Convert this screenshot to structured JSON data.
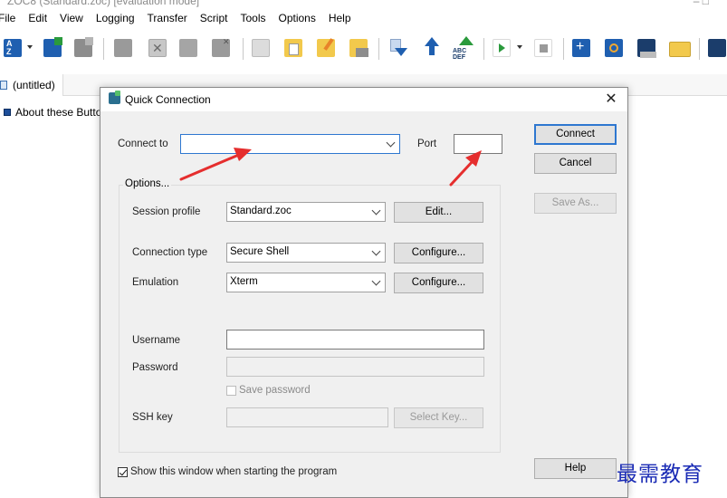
{
  "window": {
    "title": "ZOC8 (Standard.zoc) [evaluation mode]",
    "controls": "–  □"
  },
  "menubar": [
    "File",
    "Edit",
    "View",
    "Logging",
    "Transfer",
    "Script",
    "Tools",
    "Options",
    "Help"
  ],
  "toolbar": {
    "icons": [
      "sort-az-icon",
      "new-terminal-icon",
      "terminal-icon",
      "session-icon",
      "disconnect-icon",
      "copy-icon",
      "close-tab-icon",
      "copy-doc-icon",
      "paste-icon",
      "edit-paste-icon",
      "print-paste-icon",
      "download-icon",
      "upload-icon",
      "abc-def-icon",
      "play-icon",
      "stop-icon",
      "add-icon",
      "target-icon",
      "script-icon",
      "folder-icon",
      "terminal-dark-icon"
    ],
    "colors": {
      "blue": "#1f5fb0",
      "green": "#2a9a3c",
      "yellow": "#f2c94c",
      "gray": "#8d8d8d"
    }
  },
  "tab": {
    "label": "(untitled)"
  },
  "buttonbar": {
    "label": "About these Buttons"
  },
  "dialog": {
    "title": "Quick Connection",
    "close_glyph": "✕",
    "connect_to_label": "Connect to",
    "connect_to_value": "",
    "port_label": "Port",
    "port_value": "",
    "options_label": "Options...",
    "session_profile_label": "Session profile",
    "session_profile_value": "Standard.zoc",
    "edit_button": "Edit...",
    "connection_type_label": "Connection type",
    "connection_type_value": "Secure Shell",
    "configure_button_1": "Configure...",
    "emulation_label": "Emulation",
    "emulation_value": "Xterm",
    "configure_button_2": "Configure...",
    "username_label": "Username",
    "username_value": "",
    "password_label": "Password",
    "password_value": "",
    "save_password_label": "Save password",
    "save_password_checked": false,
    "ssh_key_label": "SSH key",
    "ssh_key_value": "",
    "select_key_button": "Select Key...",
    "show_window_label": "Show this window when starting the program",
    "show_window_checked": true,
    "connect_button": "Connect",
    "cancel_button": "Cancel",
    "save_as_button": "Save As...",
    "help_button": "Help",
    "accent_color": "#2e77d0"
  },
  "annotations": {
    "arrow_color": "#e52e2e"
  },
  "watermark": "最需教育"
}
